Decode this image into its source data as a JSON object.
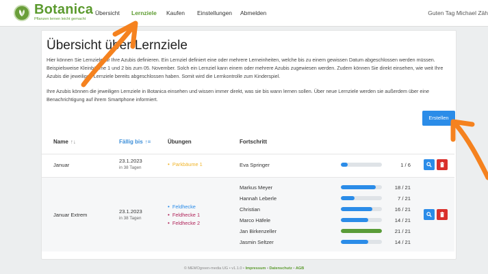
{
  "brand": {
    "name": "Botanica",
    "tagline": "Pflanzen lernen leicht gemacht"
  },
  "nav": {
    "items": [
      "Übersicht",
      "Lernziele",
      "Kaufen",
      "Einstellungen",
      "Abmelden"
    ],
    "active": "Lernziele",
    "greeting": "Guten Tag Michael Zäh"
  },
  "page": {
    "title": "Übersicht über Lernziele",
    "intro1": "Hier können Sie Lernziele für Ihre Azubis definieren. Ein Lernziel definiert eine oder mehrere Lerneinheiten, welche bis zu einem gewissen Datum abgeschlossen werden müssen. Beispielsweise Kleinbäume 1 und 2 bis zum 05. November. Solch ein Lernziel kann einem oder mehrere Azubis zugewiesen werden. Zudem können Sie direkt einsehen, wie weit Ihre Azubis die jeweiligen Lernziele bereits abgeschlossen haben. Somit wird die Lernkontrolle zum Kinderspiel.",
    "intro2": "Ihre Azubis können die jeweiligen Lernziele in Botanica einsehen und wissen immer direkt, was sie bis wann lernen sollen. Über neue Lernziele werden sie außerdem über eine Benachrichtigung auf ihrem Smartphone informiert.",
    "create_label": "Erstellen"
  },
  "table": {
    "headers": {
      "name": "Name",
      "due": "Fällig bis",
      "exercises": "Übungen",
      "progress": "Fortschritt"
    },
    "rows": [
      {
        "name": "Januar",
        "date": "23.1.2023",
        "due_in": "in 38 Tagen",
        "exercises": [
          {
            "label": "Parkbäume 1",
            "color": "#f0b429"
          }
        ],
        "people": [
          {
            "name": "Eva Springer",
            "done": 1,
            "total": 6,
            "count": "1 / 6",
            "color": "#2b8ce8"
          }
        ]
      },
      {
        "name": "Januar Extrem",
        "date": "23.1.2023",
        "due_in": "in 38 Tagen",
        "exercises": [
          {
            "label": "Feldhecke",
            "color": "#2b8ce8"
          },
          {
            "label": "Feldhecke 1",
            "color": "#b0245a"
          },
          {
            "label": "Feldhecke 2",
            "color": "#b0245a"
          }
        ],
        "people": [
          {
            "name": "Markus Meyer",
            "done": 18,
            "total": 21,
            "count": "18 / 21",
            "color": "#2b8ce8"
          },
          {
            "name": "Hannah Leberle",
            "done": 7,
            "total": 21,
            "count": "7 / 21",
            "color": "#2b8ce8"
          },
          {
            "name": "Christian",
            "done": 16,
            "total": 21,
            "count": "16 / 21",
            "color": "#2b8ce8"
          },
          {
            "name": "Marco Häfele",
            "done": 14,
            "total": 21,
            "count": "14 / 21",
            "color": "#2b8ce8"
          },
          {
            "name": "Jan Birkenzeller",
            "done": 21,
            "total": 21,
            "count": "21 / 21",
            "color": "#5a9c38"
          },
          {
            "name": "Jasmin Seltzer",
            "done": 14,
            "total": 21,
            "count": "14 / 21",
            "color": "#2b8ce8"
          }
        ]
      }
    ]
  },
  "footer": {
    "copyright": "© MEMOgreen-media UG",
    "version": "v1.1.0",
    "links": [
      "Impressum",
      "Datenschutz",
      "AGB"
    ]
  },
  "colors": {
    "brand_green": "#5b9a2e",
    "primary_blue": "#2b8ce8",
    "danger_red": "#d9302c",
    "annotation_orange": "#f5821f"
  }
}
